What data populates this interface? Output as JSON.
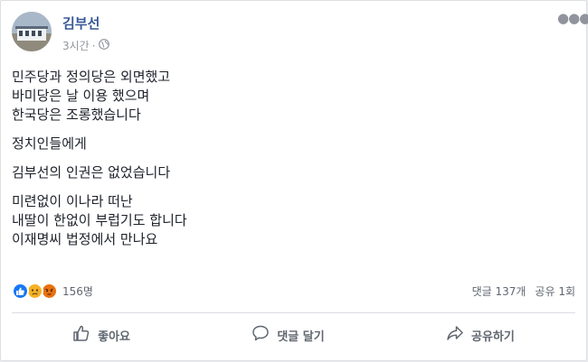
{
  "post": {
    "author": "김부선",
    "time": "3시간",
    "separator": "·",
    "lines": [
      [
        "민주당과 정의당은 외면했고",
        "바미당은 날 이용 했으며",
        "한국당은 조롱했습니다"
      ],
      [
        "정치인들에게"
      ],
      [
        "김부선의 인권은 없었습니다"
      ],
      [
        "미련없이 이나라 떠난",
        "내딸이 한없이 부럽기도 합니다",
        "이재명씨 법정에서 만나요"
      ]
    ]
  },
  "stats": {
    "reaction_count": "156명",
    "comments": "댓글 137개",
    "shares": "공유 1회",
    "reactions": [
      "like-icon",
      "sad-icon",
      "angry-icon"
    ]
  },
  "actions": {
    "like": "좋아요",
    "comment": "댓글 달기",
    "share": "공유하기"
  },
  "colors": {
    "name": "#385898",
    "like": "#1877f2",
    "sad": "#f7b125",
    "angry": "#e9710f"
  }
}
